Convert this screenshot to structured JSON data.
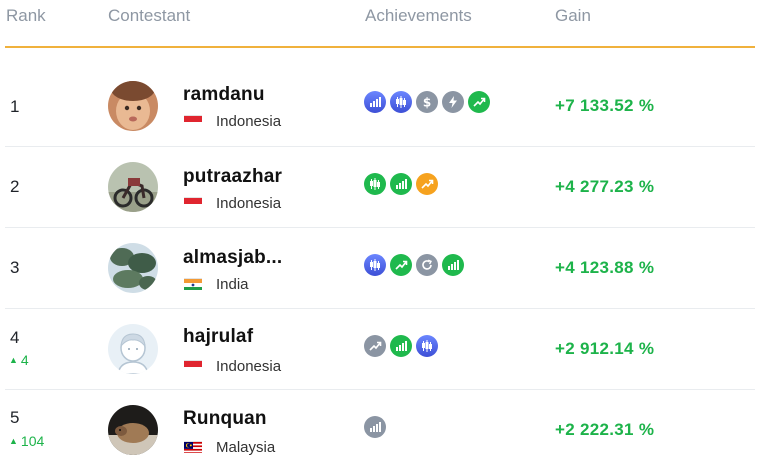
{
  "header": {
    "rank": "Rank",
    "contestant": "Contestant",
    "achievements": "Achievements",
    "gain": "Gain"
  },
  "rows": [
    {
      "rank": "1",
      "rank_change": "",
      "name": "ramdanu",
      "country": "Indonesia",
      "flag": "indonesia-flag",
      "achievements": [
        "bar-chart-icon",
        "candlestick-icon",
        "dollar-icon",
        "lightning-icon",
        "trend-up-icon"
      ],
      "gain": "+7 133.52 %"
    },
    {
      "rank": "2",
      "rank_change": "",
      "name": "putraazhar",
      "country": "Indonesia",
      "flag": "indonesia-flag",
      "achievements": [
        "candlestick-icon",
        "bar-chart-icon",
        "trend-up-icon"
      ],
      "gain": "+4 277.23 %"
    },
    {
      "rank": "3",
      "rank_change": "",
      "name": "almasjab...",
      "country": "India",
      "flag": "india-flag",
      "achievements": [
        "candlestick-icon",
        "trend-up-icon",
        "refresh-icon",
        "bar-chart-icon"
      ],
      "gain": "+4 123.88 %"
    },
    {
      "rank": "4",
      "rank_change": "4",
      "name": "hajrulaf",
      "country": "Indonesia",
      "flag": "indonesia-flag",
      "achievements": [
        "trend-up-icon",
        "bar-chart-icon",
        "candlestick-icon"
      ],
      "gain": "+2 912.14 %"
    },
    {
      "rank": "5",
      "rank_change": "104",
      "name": "Runquan",
      "country": "Malaysia",
      "flag": "malaysia-flag",
      "achievements": [
        "bar-chart-icon"
      ],
      "gain": "+2 222.31 %"
    }
  ],
  "colors": {
    "accent_line": "#f0b13c",
    "gain_green": "#1db34a",
    "badge_blue": "#4a5ee8",
    "badge_gray": "#8b95a3",
    "badge_green": "#1fb94d",
    "badge_orange": "#f6a21e"
  }
}
